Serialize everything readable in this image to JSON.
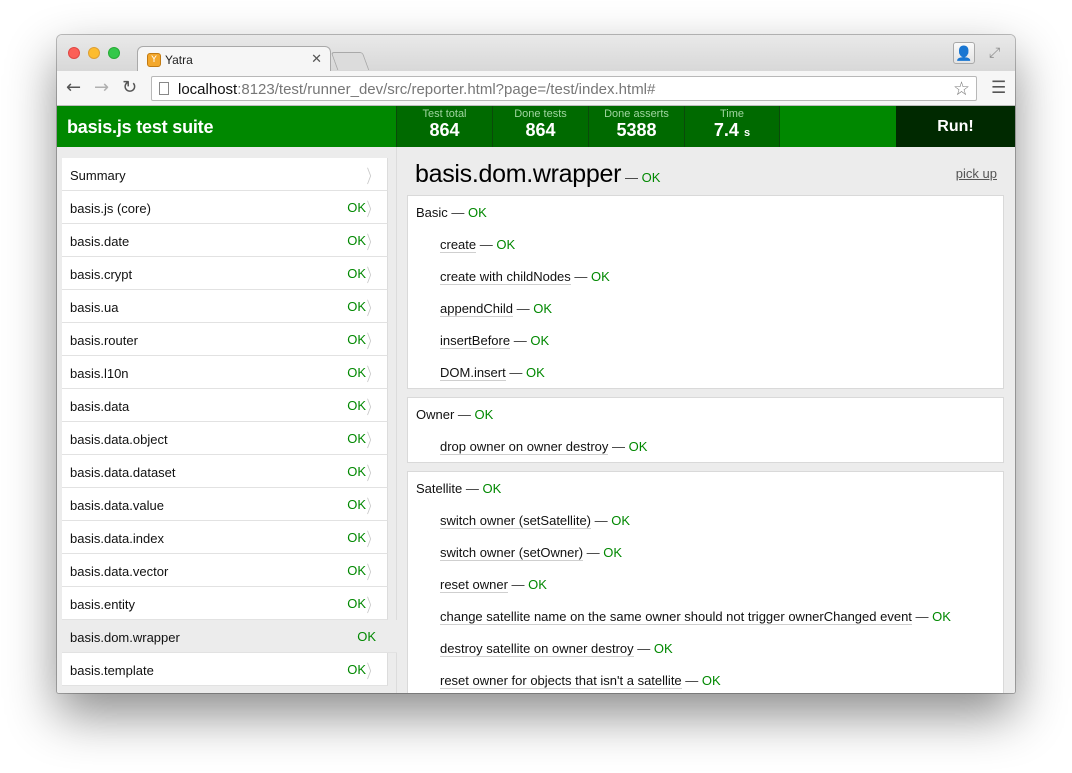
{
  "browser": {
    "tab_title": "Yatra",
    "tab_favicon": "Y",
    "url_host": "localhost",
    "url_rest": ":8123/test/runner_dev/src/reporter.html?page=/test/index.html#"
  },
  "header": {
    "title": "basis.js test suite",
    "stats": [
      {
        "label": "Test total",
        "value": "864",
        "unit": ""
      },
      {
        "label": "Done tests",
        "value": "864",
        "unit": ""
      },
      {
        "label": "Done asserts",
        "value": "5388",
        "unit": ""
      },
      {
        "label": "Time",
        "value": "7.4",
        "unit": "s"
      }
    ],
    "run_label": "Run!"
  },
  "sidebar": {
    "items": [
      {
        "name": "Summary",
        "status": ""
      },
      {
        "name": "basis.js (core)",
        "status": "OK"
      },
      {
        "name": "basis.date",
        "status": "OK"
      },
      {
        "name": "basis.crypt",
        "status": "OK"
      },
      {
        "name": "basis.ua",
        "status": "OK"
      },
      {
        "name": "basis.router",
        "status": "OK"
      },
      {
        "name": "basis.l10n",
        "status": "OK"
      },
      {
        "name": "basis.data",
        "status": "OK"
      },
      {
        "name": "basis.data.object",
        "status": "OK"
      },
      {
        "name": "basis.data.dataset",
        "status": "OK"
      },
      {
        "name": "basis.data.value",
        "status": "OK"
      },
      {
        "name": "basis.data.index",
        "status": "OK"
      },
      {
        "name": "basis.data.vector",
        "status": "OK"
      },
      {
        "name": "basis.entity",
        "status": "OK"
      },
      {
        "name": "basis.dom.wrapper",
        "status": "OK"
      },
      {
        "name": "basis.template",
        "status": "OK"
      }
    ]
  },
  "main": {
    "title": "basis.dom.wrapper",
    "title_status": "OK",
    "pickup_label": "pick up",
    "groups": [
      {
        "name": "Basic",
        "status": "OK",
        "tests": [
          {
            "name": "create",
            "status": "OK"
          },
          {
            "name": "create with childNodes",
            "status": "OK"
          },
          {
            "name": "appendChild",
            "status": "OK"
          },
          {
            "name": "insertBefore",
            "status": "OK"
          },
          {
            "name": "DOM.insert",
            "status": "OK"
          }
        ]
      },
      {
        "name": "Owner",
        "status": "OK",
        "tests": [
          {
            "name": "drop owner on owner destroy",
            "status": "OK"
          }
        ]
      },
      {
        "name": "Satellite",
        "status": "OK",
        "tests": [
          {
            "name": "switch owner (setSatellite)",
            "status": "OK"
          },
          {
            "name": "switch owner (setOwner)",
            "status": "OK"
          },
          {
            "name": "reset owner",
            "status": "OK"
          },
          {
            "name": "change satellite name on the same owner should not trigger ownerChanged event",
            "status": "OK"
          },
          {
            "name": "destroy satellite on owner destroy",
            "status": "OK"
          },
          {
            "name": "reset owner for objects that isn't a satellite",
            "status": "OK"
          }
        ]
      }
    ]
  },
  "colors": {
    "accent_green": "#008800",
    "header_dark": "#006a00",
    "run_bg": "#002900"
  }
}
